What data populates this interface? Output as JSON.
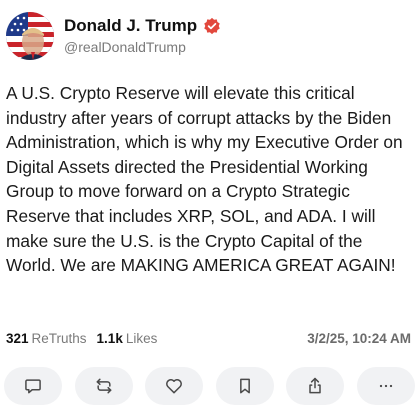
{
  "author": {
    "name": "Donald J. Trump",
    "handle": "@realDonaldTrump",
    "verified": true,
    "verified_color": "#e2483d"
  },
  "post": {
    "text": "A U.S. Crypto Reserve will elevate this critical industry after years of corrupt attacks by the Biden Administration, which is why my Executive Order on Digital Assets directed the Presidential Working Group to move forward on a Crypto Strategic Reserve that includes XRP, SOL, and ADA. I will make sure the U.S. is the Crypto Capital of the World. We are MAKING AMERICA GREAT AGAIN!"
  },
  "stats": {
    "retruths_count": "321",
    "retruths_label": "ReTruths",
    "likes_count": "1.1k",
    "likes_label": "Likes",
    "timestamp": "3/2/25, 10:24 AM"
  },
  "actions": [
    {
      "icon": "reply-icon"
    },
    {
      "icon": "retruth-icon"
    },
    {
      "icon": "heart-icon"
    },
    {
      "icon": "bookmark-icon"
    },
    {
      "icon": "share-icon"
    },
    {
      "icon": "more-icon"
    }
  ]
}
